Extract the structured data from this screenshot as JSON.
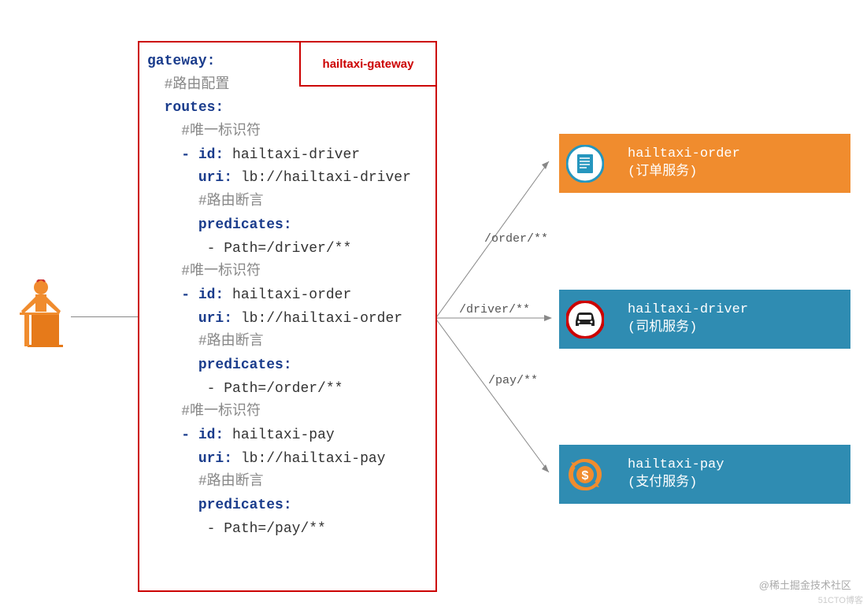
{
  "gateway_label": "hailtaxi-gateway",
  "config": {
    "gateway": "gateway:",
    "route_comment": "#路由配置",
    "routes": "routes:",
    "id_comment": "#唯一标识符",
    "pred_comment": "#路由断言",
    "predicates": "predicates:",
    "r1": {
      "id": "- id: hailtaxi-driver",
      "uri": "uri: lb://hailtaxi-driver",
      "path": "- Path=/driver/**"
    },
    "r2": {
      "id": "- id: hailtaxi-order",
      "uri": "uri: lb://hailtaxi-order",
      "path": "- Path=/order/**"
    },
    "r3": {
      "id": "- id: hailtaxi-pay",
      "uri": "uri: lb://hailtaxi-pay",
      "path": "- Path=/pay/**"
    }
  },
  "routes": {
    "order": "/order/**",
    "driver": "/driver/**",
    "pay": "/pay/**"
  },
  "services": {
    "order": {
      "name": "hailtaxi-order",
      "desc": "(订单服务)"
    },
    "driver": {
      "name": "hailtaxi-driver",
      "desc": "(司机服务)"
    },
    "pay": {
      "name": "hailtaxi-pay",
      "desc": "(支付服务)"
    }
  },
  "watermark1": "@稀土掘金技术社区",
  "watermark2": "51CTO博客"
}
